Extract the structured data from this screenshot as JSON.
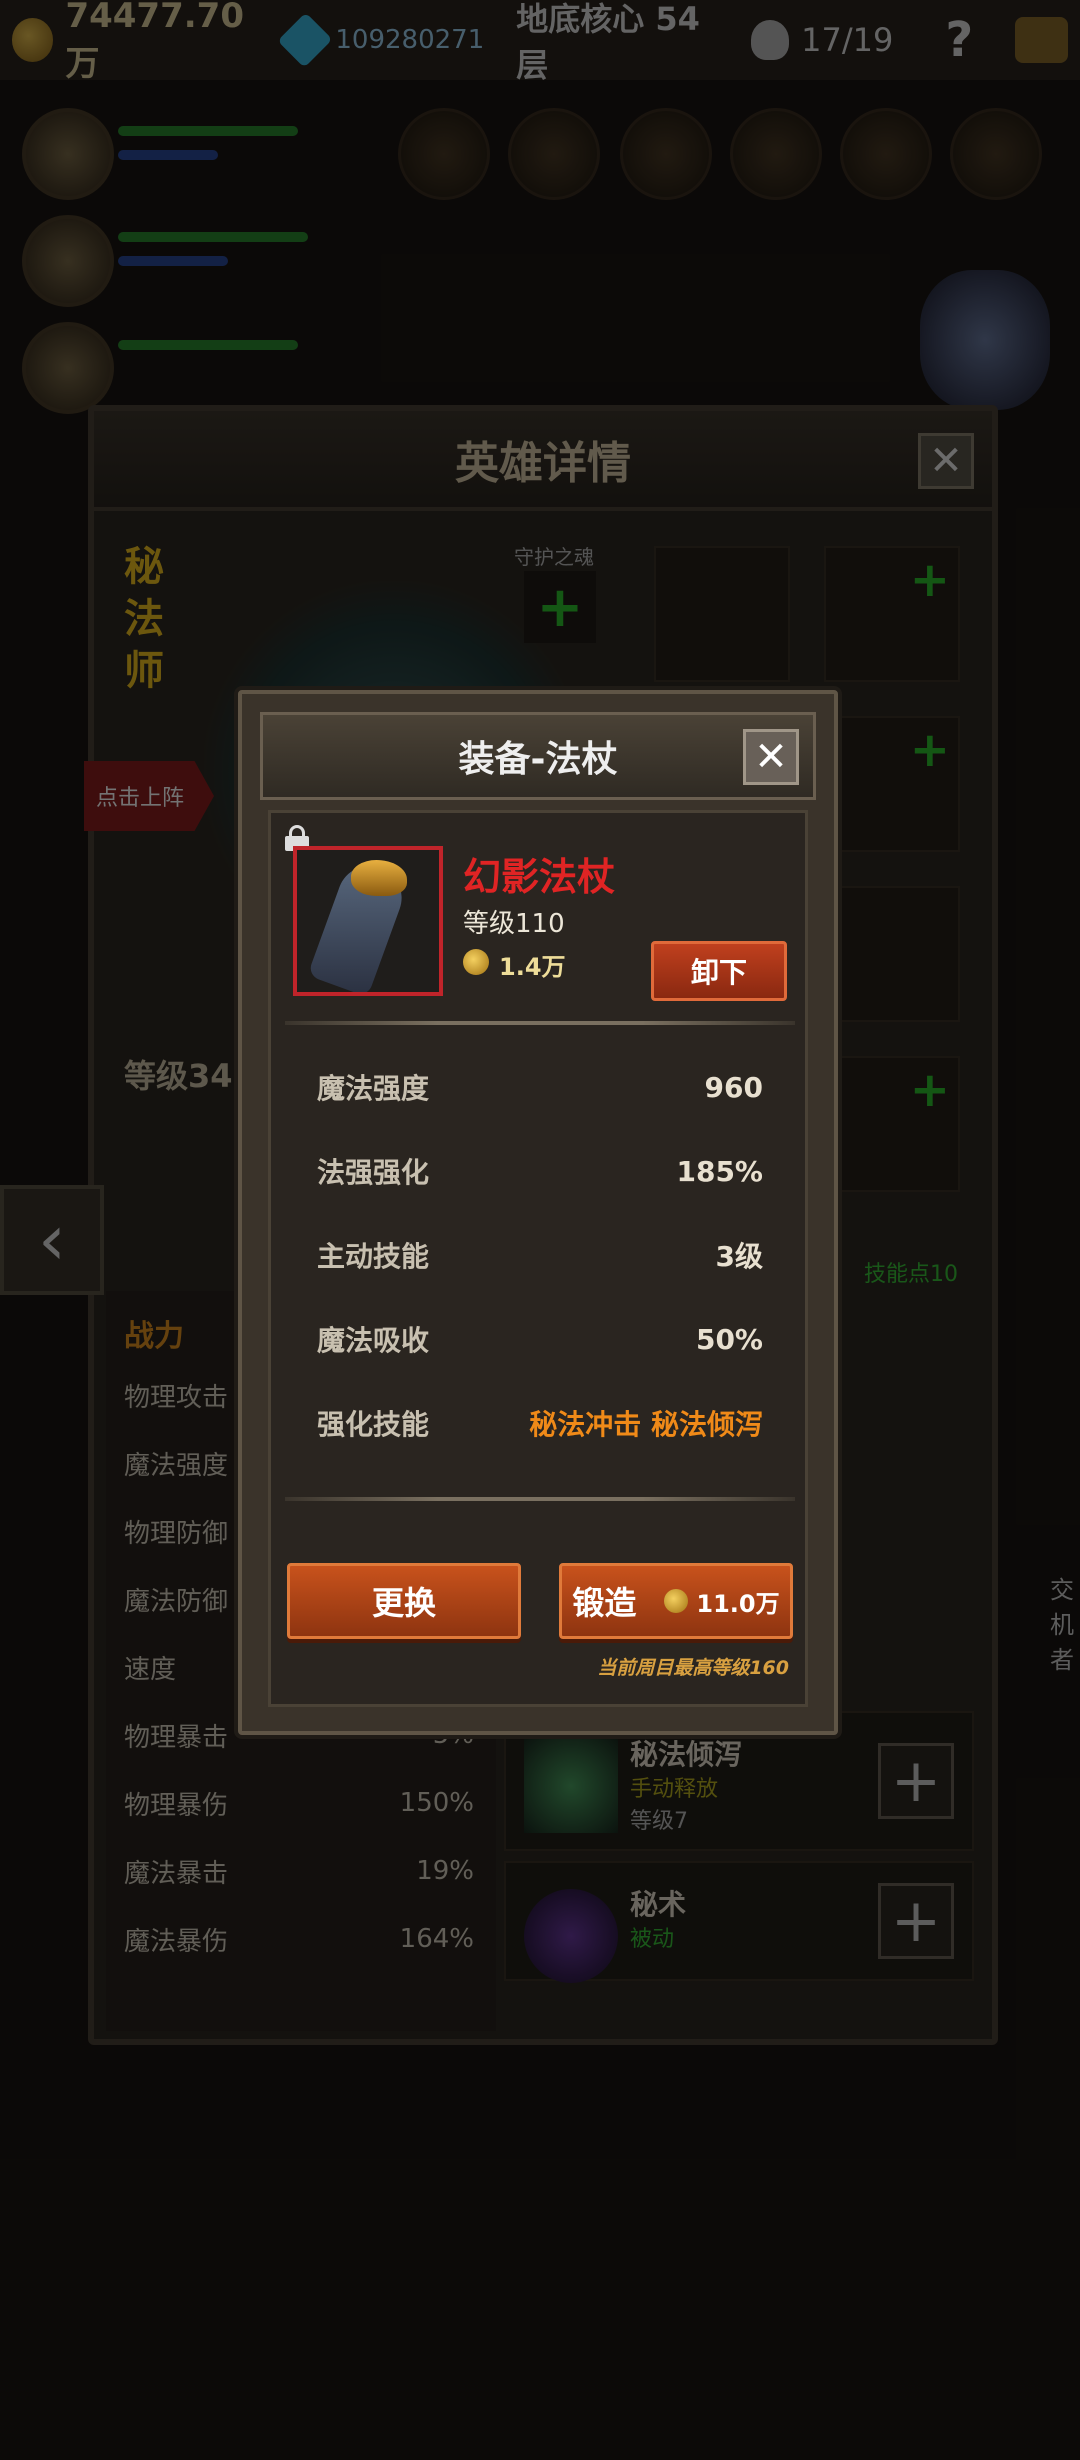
{
  "topbar": {
    "gold": "74477.70万",
    "gems": "109280271",
    "floor": "地底核心 54层",
    "count": "17/19",
    "help": "?"
  },
  "hero_panel": {
    "title": "英雄详情",
    "close": "✕",
    "class_name": "秘法师",
    "guard_label": "守护之魂",
    "deploy_label": "点击上阵",
    "level_label": "等级34",
    "power_label": "战力",
    "skill_points": "技能点10",
    "stats": [
      {
        "label": "物理攻击",
        "value": ""
      },
      {
        "label": "魔法强度",
        "value": ""
      },
      {
        "label": "物理防御",
        "value": ""
      },
      {
        "label": "魔法防御",
        "value": ""
      },
      {
        "label": "速度",
        "value": ""
      },
      {
        "label": "物理暴击",
        "value": "5%"
      },
      {
        "label": "物理暴伤",
        "value": "150%"
      },
      {
        "label": "魔法暴击",
        "value": "19%"
      },
      {
        "label": "魔法暴伤",
        "value": "164%"
      }
    ],
    "skills": [
      {
        "name": "秘法倾泻",
        "type": "手动释放",
        "level": "等级7"
      },
      {
        "name": "秘术",
        "type": "被动",
        "level": ""
      }
    ],
    "side_text": "交机者"
  },
  "modal": {
    "title": "装备-法杖",
    "close": "✕",
    "item": {
      "name": "幻影法杖",
      "level": "等级110",
      "price": "1.4万",
      "unequip_label": "卸下"
    },
    "stats": [
      {
        "label": "魔法强度",
        "value": "960"
      },
      {
        "label": "法强强化",
        "value": "185%"
      },
      {
        "label": "主动技能",
        "value": "3级"
      },
      {
        "label": "魔法吸收",
        "value": "50%"
      },
      {
        "label": "强化技能",
        "value": "秘法冲击 秘法倾泻"
      }
    ],
    "replace_label": "更换",
    "forge_label": "锻造",
    "forge_cost": "11.0万",
    "max_level_note": "当前周目最高等级160"
  },
  "colors": {
    "item_name": "#e02424",
    "button": "#c8521c",
    "enhance_skill": "#f08a18",
    "plus_green": "#2ec02e"
  }
}
